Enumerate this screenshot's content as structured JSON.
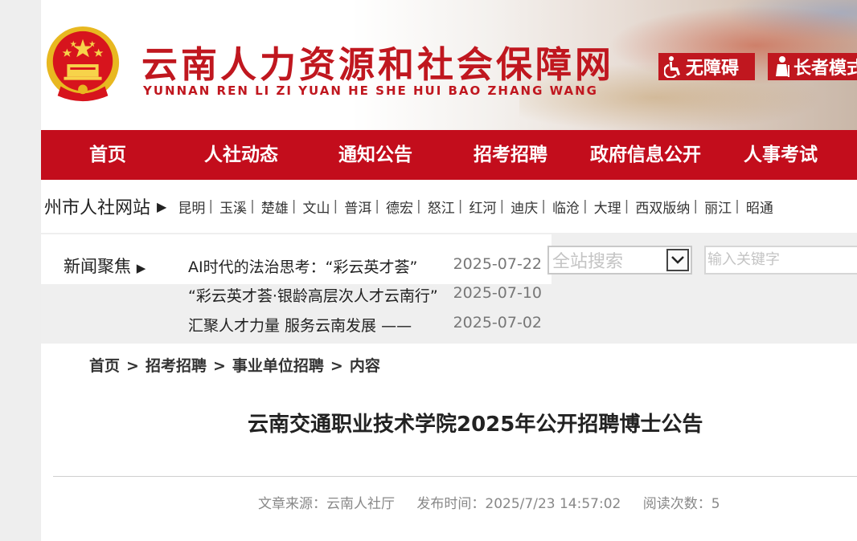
{
  "header": {
    "site_title": "云南人力资源和社会保障网",
    "site_pinyin": "YUNNAN REN LI ZI YUAN HE SHE HUI BAO ZHANG WANG",
    "accessibility_label": "无障碍",
    "elder_mode_label": "长者模式",
    "brand_color": "#c0171f"
  },
  "nav": {
    "items": [
      {
        "label": "首页"
      },
      {
        "label": "人社动态"
      },
      {
        "label": "通知公告"
      },
      {
        "label": "招考招聘"
      },
      {
        "label": "政府信息公开"
      },
      {
        "label": "人事考试"
      }
    ],
    "bg_color": "#c30d1c"
  },
  "cities": {
    "title": "州市人社网站",
    "items": [
      "昆明",
      "玉溪",
      "楚雄",
      "文山",
      "普洱",
      "德宏",
      "怒江",
      "红河",
      "迪庆",
      "临沧",
      "大理",
      "西双版纳",
      "丽江",
      "昭通"
    ]
  },
  "news": {
    "title": "新闻聚焦",
    "items": [
      {
        "title": "AI时代的法治思考：“彩云英才荟”",
        "date": "2025-07-22"
      },
      {
        "title": "“彩云英才荟·银龄高层次人才云南行”",
        "date": "2025-07-10"
      },
      {
        "title": "汇聚人才力量 服务云南发展 —— ",
        "date": "2025-07-02"
      }
    ]
  },
  "search": {
    "scope_placeholder": "全站搜索",
    "keyword_placeholder": "输入关键字"
  },
  "breadcrumb": {
    "items": [
      "首页",
      "招考招聘",
      "事业单位招聘",
      "内容"
    ]
  },
  "article": {
    "title": "云南交通职业技术学院2025年公开招聘博士公告",
    "source": "文章来源：云南人社厅",
    "publish_time": "发布时间：2025/7/23 14:57:02",
    "views": "阅读次数：5"
  }
}
